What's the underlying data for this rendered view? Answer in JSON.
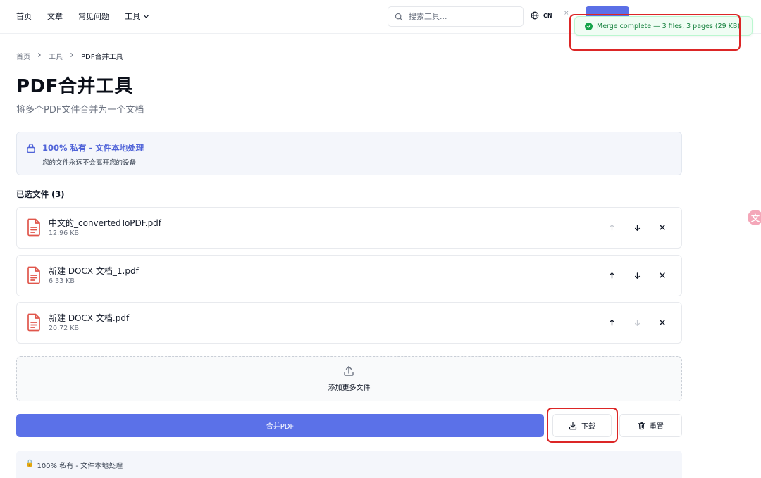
{
  "nav": {
    "items": [
      {
        "label": "首页"
      },
      {
        "label": "文章"
      },
      {
        "label": "常见问题"
      },
      {
        "label": "工具"
      }
    ]
  },
  "search": {
    "placeholder": "搜索工具..."
  },
  "lang": {
    "label": "CN"
  },
  "header": {
    "close_glyph": "×"
  },
  "toast": {
    "message": "Merge complete — 3 files, 3 pages (29 KB)"
  },
  "breadcrumb": {
    "items": [
      {
        "label": "首页"
      },
      {
        "label": "工具"
      },
      {
        "label": "PDF合并工具"
      }
    ]
  },
  "page": {
    "title": "PDF合并工具",
    "subtitle": "将多个PDF文件合并为一个文档"
  },
  "privacy": {
    "title": "100% 私有 - 文件本地处理",
    "description": "您的文件永远不会离开您的设备"
  },
  "files": {
    "heading": "已选文件 (3)",
    "list": [
      {
        "name": "中文的_convertedToPDF.pdf",
        "size": "12.96 KB"
      },
      {
        "name": "新建 DOCX 文档_1.pdf",
        "size": "6.33 KB"
      },
      {
        "name": "新建 DOCX 文档.pdf",
        "size": "20.72 KB"
      }
    ]
  },
  "addmore": {
    "label": "添加更多文件"
  },
  "actions": {
    "merge_label": "合并PDF",
    "download_label": "下载",
    "reset_label": "重置"
  },
  "bottom_privacy": {
    "label": "100% 私有 - 文件本地处理"
  },
  "side_badge": {
    "glyph": "文"
  },
  "colors": {
    "accent": "#5b71e8",
    "success": "#16a34a",
    "annotation": "#dc2626",
    "file_icon": "#e0564b"
  }
}
